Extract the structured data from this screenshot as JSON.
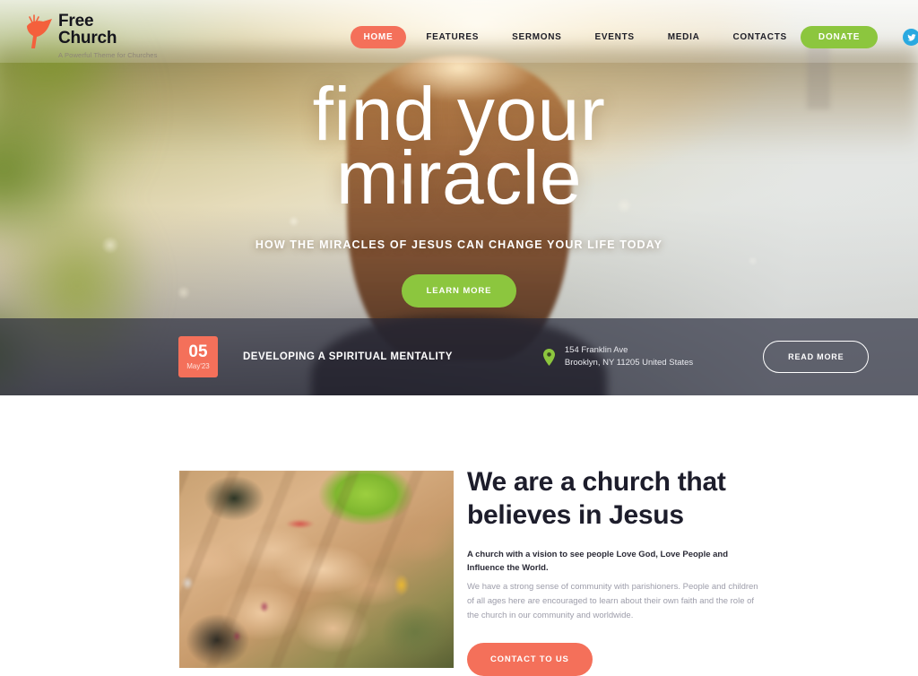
{
  "header": {
    "logo": {
      "line1": "Free",
      "line2": "Church",
      "tagline": "A Powerful Theme for Churches",
      "mark_icon": "dove-logo-icon",
      "mark_color": "#f4603c"
    },
    "nav": [
      {
        "label": "HOME",
        "active": true
      },
      {
        "label": "FEATURES",
        "active": false
      },
      {
        "label": "SERMONS",
        "active": false
      },
      {
        "label": "EVENTS",
        "active": false
      },
      {
        "label": "MEDIA",
        "active": false
      },
      {
        "label": "CONTACTS",
        "active": false
      }
    ],
    "donate_label": "DONATE",
    "donate_color": "#8cc63e",
    "active_nav_color": "#f4705a",
    "social": [
      {
        "name": "twitter-icon",
        "color": "#2aa9e0"
      },
      {
        "name": "facebook-icon",
        "color": "#3b5998"
      },
      {
        "name": "instagram-icon",
        "color": "#5d7a86"
      },
      {
        "name": "flickr-icon",
        "color": "#f06ea9"
      }
    ]
  },
  "hero": {
    "title_line1": "find your",
    "title_line2": "miracle",
    "subtitle": "HOW THE MIRACLES OF JESUS CAN CHANGE YOUR LIFE TODAY",
    "cta_label": "LEARN MORE",
    "cta_color": "#8cc63e"
  },
  "event_bar": {
    "day": "05",
    "month": "May'23",
    "date_badge_color": "#f4705a",
    "title": "DEVELOPING A SPIRITUAL MENTALITY",
    "location_icon": "map-pin-icon",
    "location_icon_color": "#8cc63e",
    "address_line1": "154 Franklin Ave",
    "address_line2": "Brooklyn, NY 11205 United States",
    "read_more_label": "READ MORE"
  },
  "about": {
    "image_alt": "stacked-hands-photo",
    "title_line1": "We are a church that",
    "title_line2": "believes in Jesus",
    "lead": "A church with a vision to see people Love God, Love People and Influence the World.",
    "body": "We have a strong sense of community with parishioners. People and children of all ages here are encouraged to learn about their own faith and the role of the church in our community and worldwide.",
    "cta_label": "CONTACT TO US",
    "cta_color": "#f4705a"
  }
}
